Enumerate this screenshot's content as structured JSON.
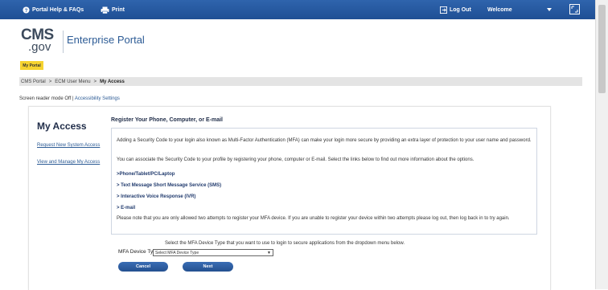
{
  "topbar": {
    "help_label": "Portal Help & FAQs",
    "print_label": "Print",
    "logout_label": "Log Out",
    "welcome_label": "Welcome"
  },
  "header": {
    "logo_cms": "CMS",
    "logo_gov": ".gov",
    "portal_name": "Enterprise Portal",
    "my_portal_tab": "My Portal"
  },
  "breadcrumb": [
    "CMS Portal",
    "ECM User Menu",
    "My Access"
  ],
  "accessibility": {
    "screen_reader": "Screen reader mode Off",
    "separator": "|",
    "settings": "Accessibility Settings"
  },
  "sidebar": {
    "title": "My Access",
    "links": [
      "Request New System Access",
      "View and Manage My Access"
    ]
  },
  "main": {
    "heading": "Register Your Phone, Computer, or E-mail",
    "intro": "Adding a Security Code to your login also known as Multi-Factor Authentication (MFA) can make your login more secure by providing an extra layer of protection to your user name and password.",
    "associate": "You can associate the Security Code to your profile by registering your phone, computer or E-mail. Select the links below to find out more information about the options.",
    "options": [
      "Phone/Tablet/PC/Laptop",
      "Text Message Short Message Service (SMS)",
      "Interactive Voice Response (IVR)",
      "E-mail"
    ],
    "note": "Please note that you are only allowed two attempts to register your MFA device. If you are unable to register your device within two attempts please log out, then log back in to try again.",
    "instruction": "Select the MFA Device Type that you want to use to login to secure applications from the dropdown menu below.",
    "device_label": "MFA Device Type",
    "device_select": "Select MFA Device Type",
    "cancel_label": "Cancel",
    "next_label": "Next"
  }
}
